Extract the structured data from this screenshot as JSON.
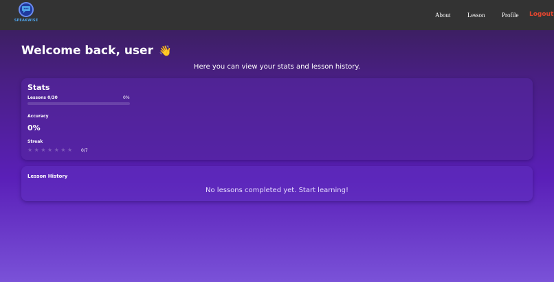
{
  "nav": {
    "logo_text": "SPEAKWISE",
    "about": "About",
    "lesson": "Lesson",
    "profile": "Profile",
    "logout": "Logout",
    "logout_color": "#e2462f"
  },
  "header": {
    "welcome": "Welcome back, user",
    "wave_emoji": "👋",
    "subtitle": "Here you can view your stats and lesson history."
  },
  "stats": {
    "title": "Stats",
    "lessons_label": "Lessons 0/30",
    "lessons_percent": "0%",
    "lessons_progress": 0,
    "accuracy_label": "Accuracy",
    "accuracy_value": "0%",
    "streak_label": "Streak",
    "streak_count": "0/7",
    "streak_filled": 0,
    "streak_total": 7
  },
  "history": {
    "title": "Lesson History",
    "empty_message": "No lessons completed yet. Start learning!"
  },
  "colors": {
    "navbar": "#333333",
    "accent": "#9d7bff"
  }
}
